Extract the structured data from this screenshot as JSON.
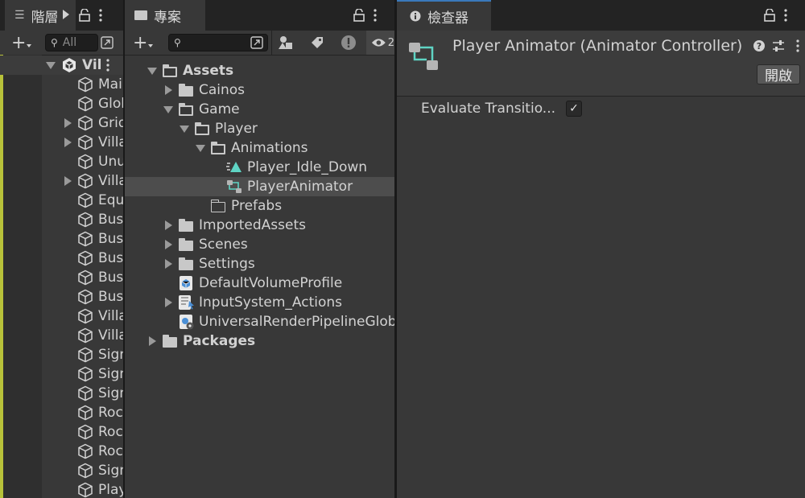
{
  "hierarchy": {
    "tab_label": "階層",
    "search_placeholder": "All",
    "add_label": "+",
    "scene_name": "Vil",
    "items": [
      {
        "label": "Mai",
        "expandable": false
      },
      {
        "label": "Glol",
        "expandable": false
      },
      {
        "label": "Grid",
        "expandable": true
      },
      {
        "label": "Villa",
        "expandable": true
      },
      {
        "label": "Unu",
        "expandable": false
      },
      {
        "label": "Villa",
        "expandable": true
      },
      {
        "label": "Equ",
        "expandable": false
      },
      {
        "label": "Bus",
        "expandable": false
      },
      {
        "label": "Bus",
        "expandable": false
      },
      {
        "label": "Bus",
        "expandable": false
      },
      {
        "label": "Bus",
        "expandable": false
      },
      {
        "label": "Bus",
        "expandable": false
      },
      {
        "label": "Villa",
        "expandable": false
      },
      {
        "label": "Villa",
        "expandable": false
      },
      {
        "label": "Sign",
        "expandable": false
      },
      {
        "label": "Sign",
        "expandable": false
      },
      {
        "label": "Sign",
        "expandable": false
      },
      {
        "label": "Roc",
        "expandable": false
      },
      {
        "label": "Roc",
        "expandable": false
      },
      {
        "label": "Roc",
        "expandable": false
      },
      {
        "label": "Sign",
        "expandable": false
      },
      {
        "label": "Play",
        "expandable": false
      }
    ]
  },
  "project": {
    "tab_label": "專案",
    "add_label": "+",
    "visibility_count": "2",
    "tree": [
      {
        "label": "Assets",
        "depth": 0,
        "arrow": "down",
        "icon": "folder-open-icon",
        "bold": true
      },
      {
        "label": "Cainos",
        "depth": 1,
        "arrow": "right",
        "icon": "folder-icon"
      },
      {
        "label": "Game",
        "depth": 1,
        "arrow": "down",
        "icon": "folder-open-icon"
      },
      {
        "label": "Player",
        "depth": 2,
        "arrow": "down",
        "icon": "folder-open-icon"
      },
      {
        "label": "Animations",
        "depth": 3,
        "arrow": "down",
        "icon": "folder-open-icon"
      },
      {
        "label": "Player_Idle_Down",
        "depth": 4,
        "arrow": "none",
        "icon": "animation-clip-icon"
      },
      {
        "label": "PlayerAnimator",
        "depth": 4,
        "arrow": "none",
        "icon": "animator-controller-icon",
        "selected": true
      },
      {
        "label": "Prefabs",
        "depth": 3,
        "arrow": "none",
        "icon": "folder-empty-icon"
      },
      {
        "label": "ImportedAssets",
        "depth": 1,
        "arrow": "right",
        "icon": "folder-icon"
      },
      {
        "label": "Scenes",
        "depth": 1,
        "arrow": "right",
        "icon": "folder-icon"
      },
      {
        "label": "Settings",
        "depth": 1,
        "arrow": "right",
        "icon": "folder-icon"
      },
      {
        "label": "DefaultVolumeProfile",
        "depth": 1,
        "arrow": "none",
        "icon": "volume-profile-icon"
      },
      {
        "label": "InputSystem_Actions",
        "depth": 1,
        "arrow": "right",
        "icon": "input-actions-icon"
      },
      {
        "label": "UniversalRenderPipelineGlobalSettings",
        "depth": 1,
        "arrow": "none",
        "icon": "urp-settings-icon"
      },
      {
        "label": "Packages",
        "depth": 0,
        "arrow": "right",
        "icon": "folder-icon",
        "bold": true
      }
    ]
  },
  "inspector": {
    "tab_label": "檢查器",
    "title": "Player Animator (Animator Controller)",
    "open_button": "開啟",
    "property_label": "Evaluate Transitio...",
    "property_checked": true,
    "help_glyph": "?",
    "check_glyph": "✓"
  },
  "colors": {
    "panel": "#383838",
    "tabbar": "#232323",
    "selection": "#4d4d4d",
    "accent_teal": "#5fd4c4",
    "hierarchy_accent": "#b8c23a",
    "inspector_tab_accent": "#3a79bb"
  }
}
